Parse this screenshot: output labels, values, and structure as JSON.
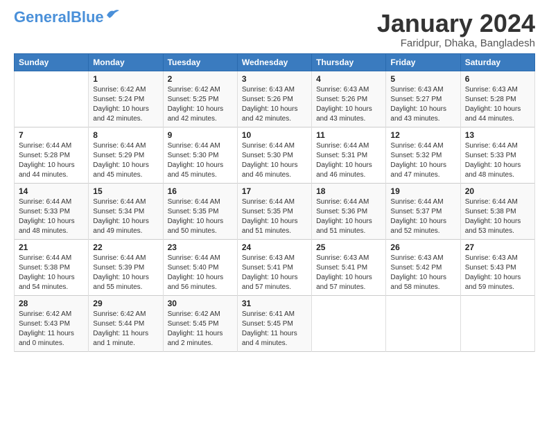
{
  "header": {
    "logo_general": "General",
    "logo_blue": "Blue",
    "month_title": "January 2024",
    "location": "Faridpur, Dhaka, Bangladesh"
  },
  "days_of_week": [
    "Sunday",
    "Monday",
    "Tuesday",
    "Wednesday",
    "Thursday",
    "Friday",
    "Saturday"
  ],
  "weeks": [
    [
      {
        "day": "",
        "sunrise": "",
        "sunset": "",
        "daylight": ""
      },
      {
        "day": "1",
        "sunrise": "Sunrise: 6:42 AM",
        "sunset": "Sunset: 5:24 PM",
        "daylight": "Daylight: 10 hours and 42 minutes."
      },
      {
        "day": "2",
        "sunrise": "Sunrise: 6:42 AM",
        "sunset": "Sunset: 5:25 PM",
        "daylight": "Daylight: 10 hours and 42 minutes."
      },
      {
        "day": "3",
        "sunrise": "Sunrise: 6:43 AM",
        "sunset": "Sunset: 5:26 PM",
        "daylight": "Daylight: 10 hours and 42 minutes."
      },
      {
        "day": "4",
        "sunrise": "Sunrise: 6:43 AM",
        "sunset": "Sunset: 5:26 PM",
        "daylight": "Daylight: 10 hours and 43 minutes."
      },
      {
        "day": "5",
        "sunrise": "Sunrise: 6:43 AM",
        "sunset": "Sunset: 5:27 PM",
        "daylight": "Daylight: 10 hours and 43 minutes."
      },
      {
        "day": "6",
        "sunrise": "Sunrise: 6:43 AM",
        "sunset": "Sunset: 5:28 PM",
        "daylight": "Daylight: 10 hours and 44 minutes."
      }
    ],
    [
      {
        "day": "7",
        "sunrise": "Sunrise: 6:44 AM",
        "sunset": "Sunset: 5:28 PM",
        "daylight": "Daylight: 10 hours and 44 minutes."
      },
      {
        "day": "8",
        "sunrise": "Sunrise: 6:44 AM",
        "sunset": "Sunset: 5:29 PM",
        "daylight": "Daylight: 10 hours and 45 minutes."
      },
      {
        "day": "9",
        "sunrise": "Sunrise: 6:44 AM",
        "sunset": "Sunset: 5:30 PM",
        "daylight": "Daylight: 10 hours and 45 minutes."
      },
      {
        "day": "10",
        "sunrise": "Sunrise: 6:44 AM",
        "sunset": "Sunset: 5:30 PM",
        "daylight": "Daylight: 10 hours and 46 minutes."
      },
      {
        "day": "11",
        "sunrise": "Sunrise: 6:44 AM",
        "sunset": "Sunset: 5:31 PM",
        "daylight": "Daylight: 10 hours and 46 minutes."
      },
      {
        "day": "12",
        "sunrise": "Sunrise: 6:44 AM",
        "sunset": "Sunset: 5:32 PM",
        "daylight": "Daylight: 10 hours and 47 minutes."
      },
      {
        "day": "13",
        "sunrise": "Sunrise: 6:44 AM",
        "sunset": "Sunset: 5:33 PM",
        "daylight": "Daylight: 10 hours and 48 minutes."
      }
    ],
    [
      {
        "day": "14",
        "sunrise": "Sunrise: 6:44 AM",
        "sunset": "Sunset: 5:33 PM",
        "daylight": "Daylight: 10 hours and 48 minutes."
      },
      {
        "day": "15",
        "sunrise": "Sunrise: 6:44 AM",
        "sunset": "Sunset: 5:34 PM",
        "daylight": "Daylight: 10 hours and 49 minutes."
      },
      {
        "day": "16",
        "sunrise": "Sunrise: 6:44 AM",
        "sunset": "Sunset: 5:35 PM",
        "daylight": "Daylight: 10 hours and 50 minutes."
      },
      {
        "day": "17",
        "sunrise": "Sunrise: 6:44 AM",
        "sunset": "Sunset: 5:35 PM",
        "daylight": "Daylight: 10 hours and 51 minutes."
      },
      {
        "day": "18",
        "sunrise": "Sunrise: 6:44 AM",
        "sunset": "Sunset: 5:36 PM",
        "daylight": "Daylight: 10 hours and 51 minutes."
      },
      {
        "day": "19",
        "sunrise": "Sunrise: 6:44 AM",
        "sunset": "Sunset: 5:37 PM",
        "daylight": "Daylight: 10 hours and 52 minutes."
      },
      {
        "day": "20",
        "sunrise": "Sunrise: 6:44 AM",
        "sunset": "Sunset: 5:38 PM",
        "daylight": "Daylight: 10 hours and 53 minutes."
      }
    ],
    [
      {
        "day": "21",
        "sunrise": "Sunrise: 6:44 AM",
        "sunset": "Sunset: 5:38 PM",
        "daylight": "Daylight: 10 hours and 54 minutes."
      },
      {
        "day": "22",
        "sunrise": "Sunrise: 6:44 AM",
        "sunset": "Sunset: 5:39 PM",
        "daylight": "Daylight: 10 hours and 55 minutes."
      },
      {
        "day": "23",
        "sunrise": "Sunrise: 6:44 AM",
        "sunset": "Sunset: 5:40 PM",
        "daylight": "Daylight: 10 hours and 56 minutes."
      },
      {
        "day": "24",
        "sunrise": "Sunrise: 6:43 AM",
        "sunset": "Sunset: 5:41 PM",
        "daylight": "Daylight: 10 hours and 57 minutes."
      },
      {
        "day": "25",
        "sunrise": "Sunrise: 6:43 AM",
        "sunset": "Sunset: 5:41 PM",
        "daylight": "Daylight: 10 hours and 57 minutes."
      },
      {
        "day": "26",
        "sunrise": "Sunrise: 6:43 AM",
        "sunset": "Sunset: 5:42 PM",
        "daylight": "Daylight: 10 hours and 58 minutes."
      },
      {
        "day": "27",
        "sunrise": "Sunrise: 6:43 AM",
        "sunset": "Sunset: 5:43 PM",
        "daylight": "Daylight: 10 hours and 59 minutes."
      }
    ],
    [
      {
        "day": "28",
        "sunrise": "Sunrise: 6:42 AM",
        "sunset": "Sunset: 5:43 PM",
        "daylight": "Daylight: 11 hours and 0 minutes."
      },
      {
        "day": "29",
        "sunrise": "Sunrise: 6:42 AM",
        "sunset": "Sunset: 5:44 PM",
        "daylight": "Daylight: 11 hours and 1 minute."
      },
      {
        "day": "30",
        "sunrise": "Sunrise: 6:42 AM",
        "sunset": "Sunset: 5:45 PM",
        "daylight": "Daylight: 11 hours and 2 minutes."
      },
      {
        "day": "31",
        "sunrise": "Sunrise: 6:41 AM",
        "sunset": "Sunset: 5:45 PM",
        "daylight": "Daylight: 11 hours and 4 minutes."
      },
      {
        "day": "",
        "sunrise": "",
        "sunset": "",
        "daylight": ""
      },
      {
        "day": "",
        "sunrise": "",
        "sunset": "",
        "daylight": ""
      },
      {
        "day": "",
        "sunrise": "",
        "sunset": "",
        "daylight": ""
      }
    ]
  ]
}
